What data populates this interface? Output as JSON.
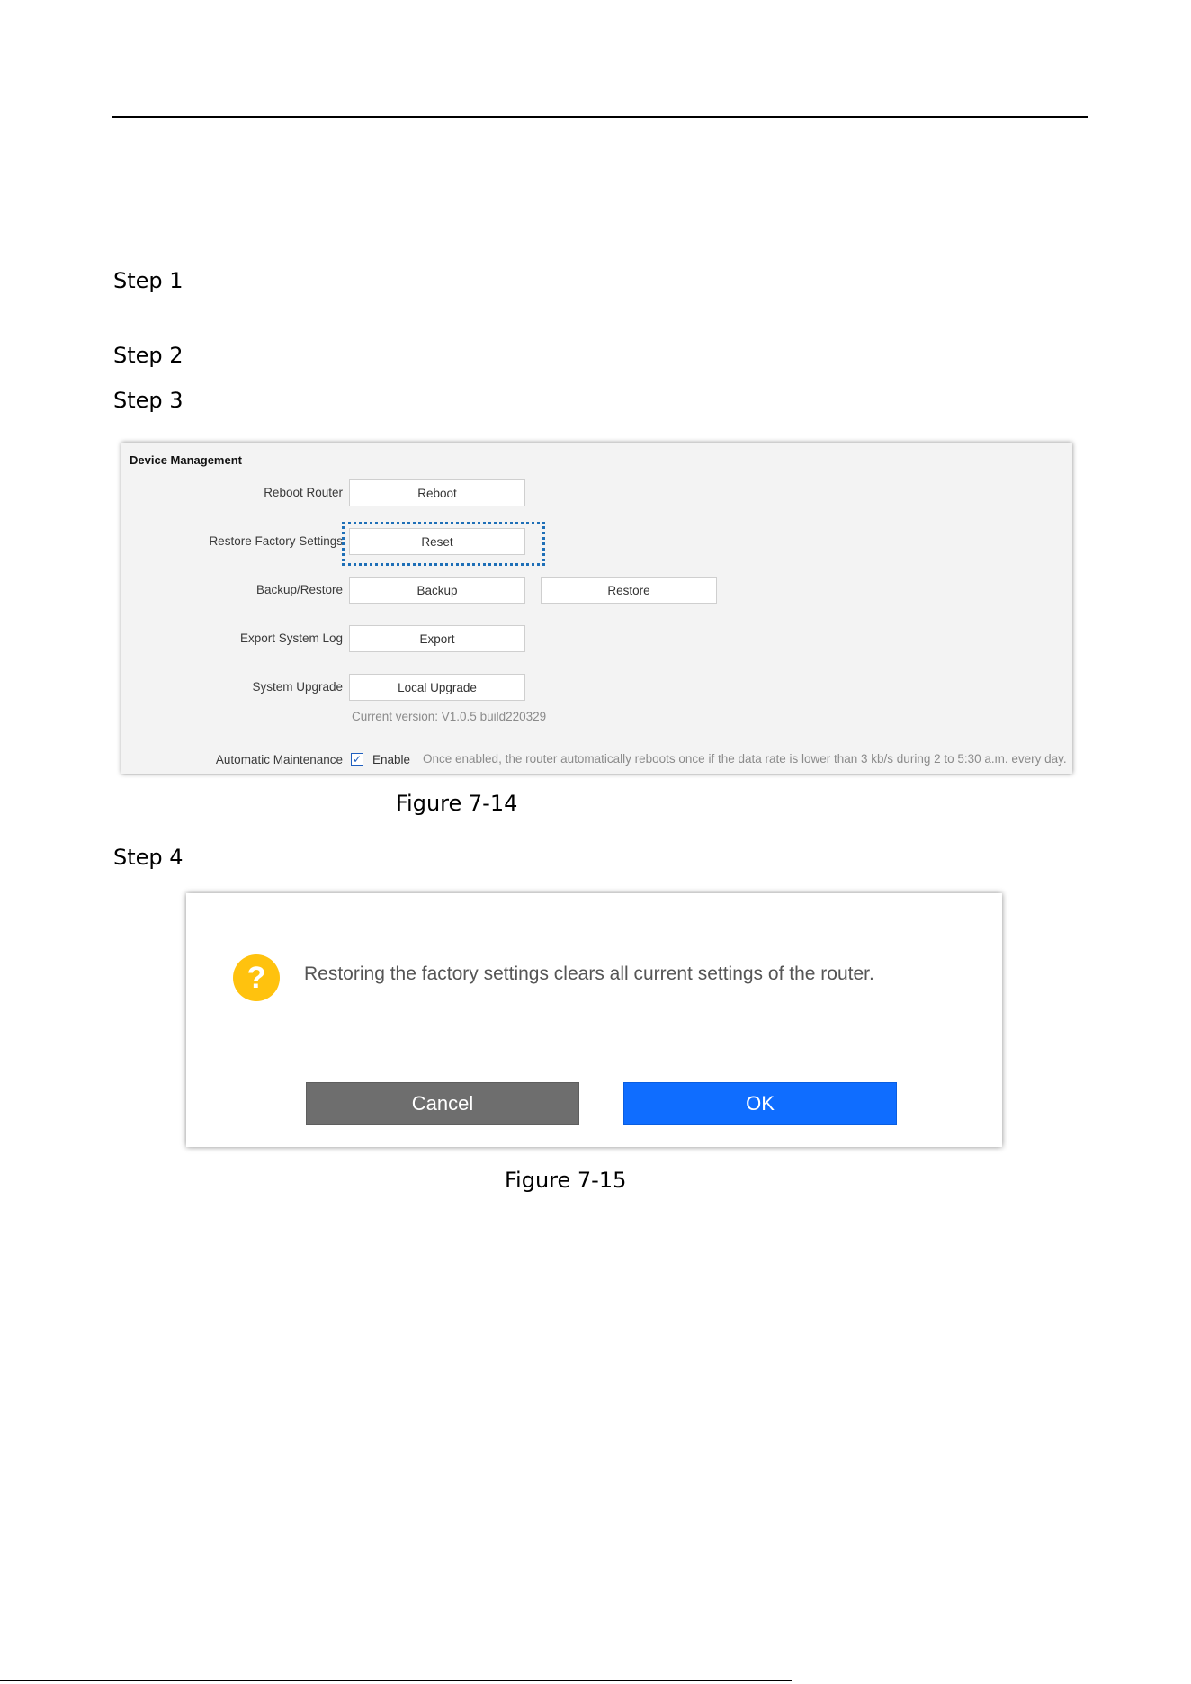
{
  "steps": [
    "Step 1",
    "Step 2",
    "Step 3",
    "Step 4"
  ],
  "figure14": {
    "caption": "Figure 7-14",
    "title": "Device Management",
    "rows": {
      "reboot": {
        "label": "Reboot Router",
        "button": "Reboot"
      },
      "restore_factory": {
        "label": "Restore Factory Settings",
        "button": "Reset"
      },
      "backup_restore": {
        "label": "Backup/Restore",
        "button": "Backup",
        "button2": "Restore"
      },
      "export_log": {
        "label": "Export System Log",
        "button": "Export"
      },
      "upgrade": {
        "label": "System Upgrade",
        "button": "Local Upgrade",
        "version": "Current version: V1.0.5 build220329"
      },
      "maintenance": {
        "label": "Automatic Maintenance",
        "checked": true,
        "option": "Enable",
        "hint": "Once enabled, the router automatically reboots once if the data rate is lower than 3 kb/s during 2 to 5:30 a.m. every day."
      }
    },
    "highlight_color": "#1e6fb7"
  },
  "figure15": {
    "caption": "Figure 7-15",
    "icon": "question-icon",
    "icon_glyph": "?",
    "icon_color": "#ffc20e",
    "message": "Restoring the factory settings clears all current settings of the router.",
    "cancel": "Cancel",
    "ok": "OK",
    "cancel_color": "#6e6e6e",
    "ok_color": "#0f6dff"
  }
}
